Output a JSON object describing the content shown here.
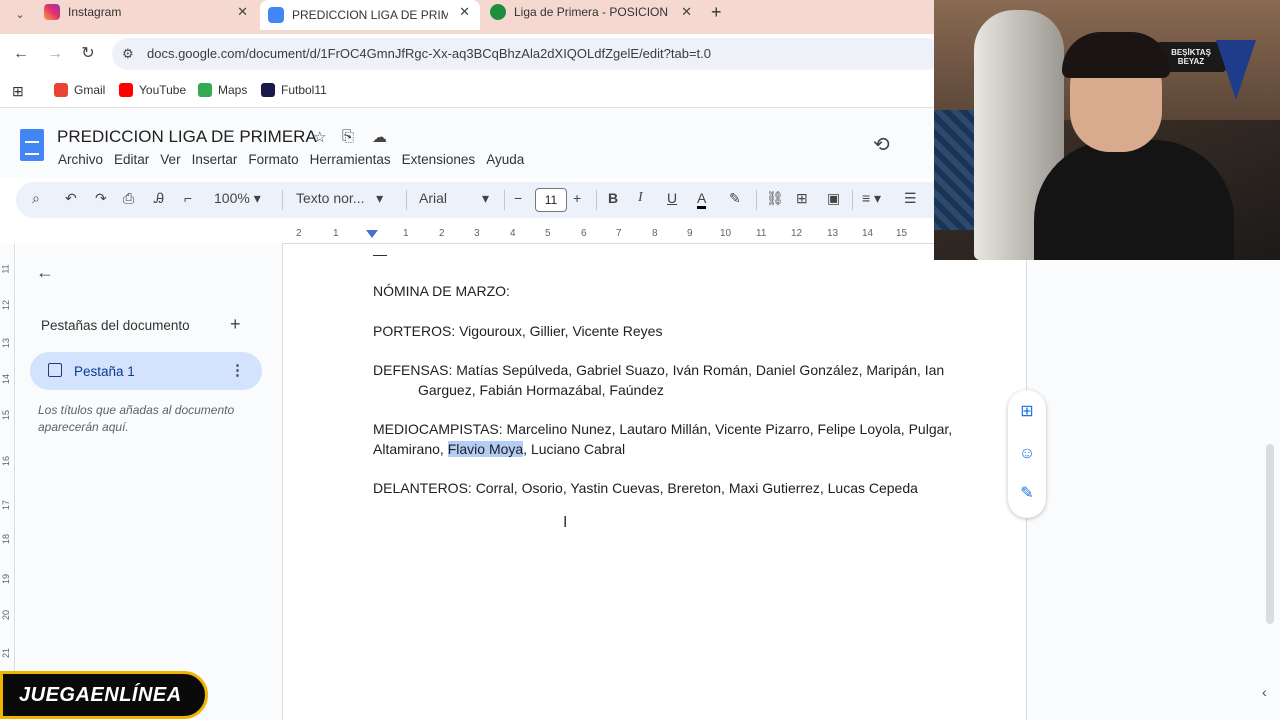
{
  "browser": {
    "tabs": [
      {
        "title": "Instagram",
        "favicon": "instagram-icon",
        "active": false
      },
      {
        "title": "PREDICCION LIGA DE PRIMERA",
        "favicon": "docs-icon",
        "active": true
      },
      {
        "title": "Liga de Primera - POSICIONES,",
        "favicon": "sheets-icon",
        "active": false
      }
    ],
    "url": "docs.google.com/document/d/1FrOC4GmnJfRgc-Xx-aq3BCqBhzAla2dXIQOLdfZgelE/edit?tab=t.0",
    "bookmarks": [
      {
        "label": "Gmail",
        "color": "#ea4335"
      },
      {
        "label": "YouTube",
        "color": "#ff0000"
      },
      {
        "label": "Maps",
        "color": "#34a853"
      },
      {
        "label": "Futbol11",
        "color": "#1a1a4a"
      }
    ]
  },
  "docs": {
    "title": "PREDICCION LIGA DE PRIMERA",
    "menus": [
      "Archivo",
      "Editar",
      "Ver",
      "Insertar",
      "Formato",
      "Herramientas",
      "Extensiones",
      "Ayuda"
    ],
    "toolbar": {
      "zoom": "100%",
      "style": "Texto nor...",
      "font": "Arial",
      "font_size": "11"
    },
    "ruler_ticks": [
      "2",
      "1",
      "1",
      "2",
      "3",
      "4",
      "5",
      "6",
      "7",
      "8",
      "9",
      "10",
      "11",
      "12",
      "13",
      "14",
      "15"
    ],
    "vruler_ticks": [
      "11",
      "12",
      "13",
      "14",
      "15",
      "16",
      "17",
      "18",
      "19",
      "20",
      "21"
    ],
    "sidebar": {
      "title": "Pestañas del documento",
      "tab_label": "Pestaña 1",
      "hint": "Los títulos que añadas al documento aparecerán aquí."
    },
    "body": {
      "dash": "—",
      "heading": "NÓMINA DE MARZO:",
      "porteros": "PORTEROS: Vigouroux, Gillier, Vicente Reyes",
      "defensas": "DEFENSAS: Matías Sepúlveda, Gabriel Suazo, Iván Román, Daniel González, Maripán, Ian Garguez, Fabián Hormazábal, Faúndez",
      "medio_before": "MEDIOCAMPISTAS: Marcelino Nunez, Lautaro Millán, Vicente Pizarro, Felipe Loyola, Pulgar, Altamirano, ",
      "medio_selected": "Flavio Moya",
      "medio_after": ", Luciano Cabral",
      "delanteros": "DELANTEROS: Corral, Osorio, Yastin Cuevas, Brereton, Maxi Gutierrez, Lucas Cepeda"
    },
    "selection_color": "#b4cdf4",
    "accent": "#1a73e8"
  },
  "webcam": {
    "flag_text": "BEŞİKTAŞ BEYAZ"
  },
  "watermark": {
    "text": "JUEGAENLÍNEA",
    "border_color": "#f0b400"
  }
}
